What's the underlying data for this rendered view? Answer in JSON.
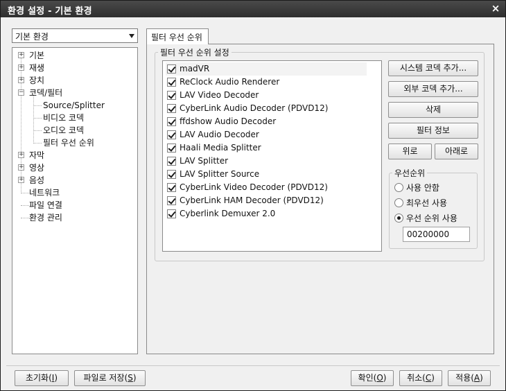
{
  "window": {
    "title": "환경 설정 - 기본 환경",
    "close_glyph": "×"
  },
  "preset": {
    "selected": "기본 환경"
  },
  "tree": {
    "items": [
      {
        "label": "기본",
        "expander": "+"
      },
      {
        "label": "재생",
        "expander": "+"
      },
      {
        "label": "장치",
        "expander": "+"
      },
      {
        "label": "코덱/필터",
        "expander": "−"
      },
      {
        "label": "Source/Splitter"
      },
      {
        "label": "비디오 코덱"
      },
      {
        "label": "오디오 코덱"
      },
      {
        "label": "필터 우선 순위"
      },
      {
        "label": "자막",
        "expander": "+"
      },
      {
        "label": "영상",
        "expander": "+"
      },
      {
        "label": "음성",
        "expander": "+"
      },
      {
        "label": "네트워크"
      },
      {
        "label": "파일 연결"
      },
      {
        "label": "환경 관리"
      }
    ]
  },
  "tab": {
    "label": "필터 우선 순위"
  },
  "group": {
    "label": "필터 우선 순위 설정"
  },
  "filters": {
    "items": [
      {
        "label": "madVR",
        "checked": true
      },
      {
        "label": "ReClock Audio Renderer",
        "checked": true
      },
      {
        "label": "LAV Video Decoder",
        "checked": true
      },
      {
        "label": "CyberLink Audio Decoder (PDVD12)",
        "checked": true
      },
      {
        "label": "ffdshow Audio Decoder",
        "checked": true
      },
      {
        "label": "LAV Audio Decoder",
        "checked": true
      },
      {
        "label": "Haali Media Splitter",
        "checked": true
      },
      {
        "label": "LAV Splitter",
        "checked": true
      },
      {
        "label": "LAV Splitter Source",
        "checked": true
      },
      {
        "label": "CyberLink Video Decoder (PDVD12)",
        "checked": true
      },
      {
        "label": "CyberLink HAM Decoder (PDVD12)",
        "checked": true
      },
      {
        "label": "Cyberlink Demuxer 2.0",
        "checked": true
      }
    ]
  },
  "buttons": {
    "add_system": "시스템 코덱 추가...",
    "add_external": "외부 코덱 추가...",
    "delete": "삭제",
    "filter_info": "필터 정보",
    "up": "위로",
    "down": "아래로"
  },
  "priority": {
    "label": "우선순위",
    "options": [
      "사용 안함",
      "최우선 사용",
      "우선 순위 사용"
    ],
    "selected": 2,
    "value": "00200000"
  },
  "footer": {
    "reset": {
      "text": "초기화(",
      "key": "I",
      "tail": ")"
    },
    "save_file": {
      "text": "파일로 저장(",
      "key": "S",
      "tail": ")"
    },
    "ok": {
      "text": "확인(",
      "key": "O",
      "tail": ")"
    },
    "cancel": {
      "text": "취소(",
      "key": "C",
      "tail": ")"
    },
    "apply": {
      "text": "적용(",
      "key": "A",
      "tail": ")"
    }
  }
}
